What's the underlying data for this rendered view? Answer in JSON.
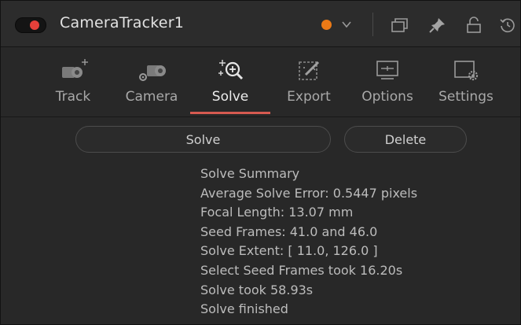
{
  "header": {
    "title": "CameraTracker1",
    "icons": [
      "toggle-enabled",
      "orange-color-dot",
      "chevron-down-icon",
      "versions-icon",
      "pin-icon",
      "lock-icon",
      "reset-icon"
    ],
    "colors": {
      "toggle": "#e5403a",
      "node_color": "#ec7a16"
    }
  },
  "tabs": [
    {
      "label": "Track",
      "icon": "track-camera-icon"
    },
    {
      "label": "Camera",
      "icon": "camera-settings-icon"
    },
    {
      "label": "Solve",
      "icon": "solve-icon",
      "active": true
    },
    {
      "label": "Export",
      "icon": "export-icon"
    },
    {
      "label": "Options",
      "icon": "options-monitor-icon"
    },
    {
      "label": "Settings",
      "icon": "settings-gear-icon"
    }
  ],
  "accent_color": "#d65a50",
  "actions": {
    "solve_label": "Solve",
    "delete_label": "Delete"
  },
  "summary": {
    "lines": [
      "Solve Summary",
      "Average Solve Error: 0.5447 pixels",
      "Focal Length: 13.07 mm",
      "Seed Frames: 41.0 and 46.0",
      "Solve Extent:  [ 11.0, 126.0 ]",
      "Select Seed Frames took 16.20s",
      "Solve took 58.93s",
      "Solve finished"
    ]
  }
}
